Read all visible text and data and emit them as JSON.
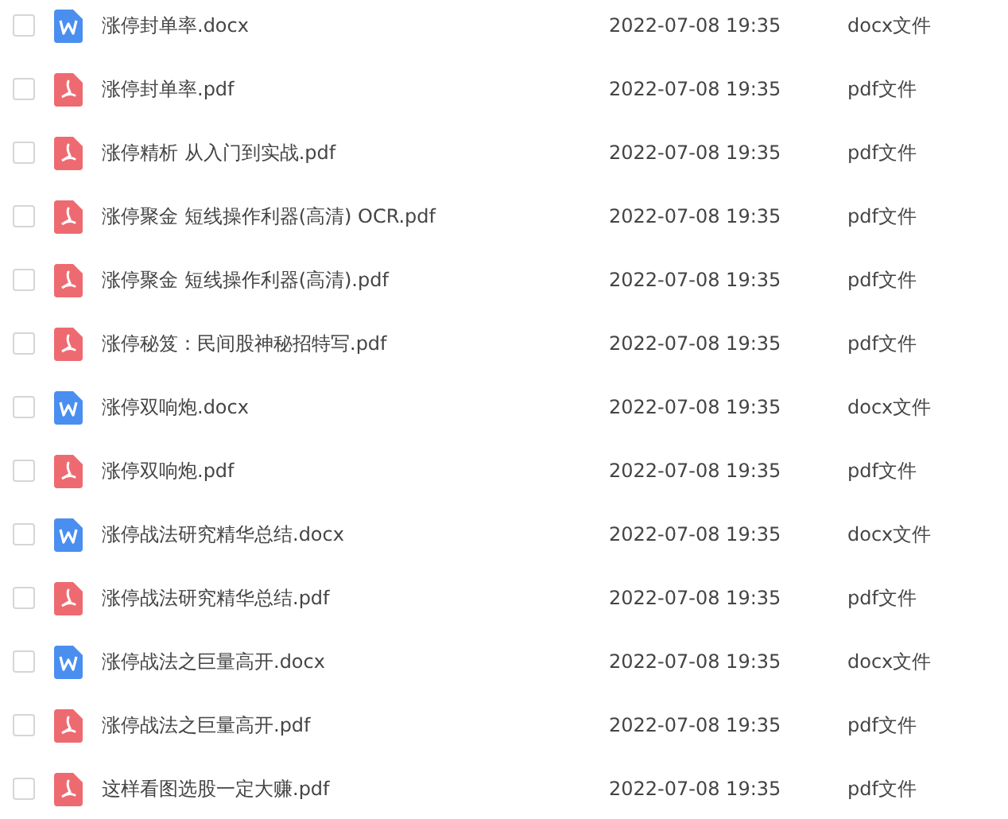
{
  "files": [
    {
      "name": "涨停封单率.docx",
      "kind": "docx",
      "checked": false,
      "date": "2022-07-08 19:35",
      "type": "docx文件"
    },
    {
      "name": "涨停封单率.pdf",
      "kind": "pdf",
      "checked": false,
      "date": "2022-07-08 19:35",
      "type": "pdf文件"
    },
    {
      "name": "涨停精析  从入门到实战.pdf",
      "kind": "pdf",
      "checked": false,
      "date": "2022-07-08 19:35",
      "type": "pdf文件"
    },
    {
      "name": "涨停聚金 短线操作利器(高清) OCR.pdf",
      "kind": "pdf",
      "checked": false,
      "date": "2022-07-08 19:35",
      "type": "pdf文件"
    },
    {
      "name": "涨停聚金 短线操作利器(高清).pdf",
      "kind": "pdf",
      "checked": false,
      "date": "2022-07-08 19:35",
      "type": "pdf文件"
    },
    {
      "name": "涨停秘笈：民间股神秘招特写.pdf",
      "kind": "pdf",
      "checked": false,
      "date": "2022-07-08 19:35",
      "type": "pdf文件"
    },
    {
      "name": "涨停双响炮.docx",
      "kind": "docx",
      "checked": false,
      "date": "2022-07-08 19:35",
      "type": "docx文件"
    },
    {
      "name": "涨停双响炮.pdf",
      "kind": "pdf",
      "checked": false,
      "date": "2022-07-08 19:35",
      "type": "pdf文件"
    },
    {
      "name": "涨停战法研究精华总结.docx",
      "kind": "docx",
      "checked": false,
      "date": "2022-07-08 19:35",
      "type": "docx文件"
    },
    {
      "name": "涨停战法研究精华总结.pdf",
      "kind": "pdf",
      "checked": false,
      "date": "2022-07-08 19:35",
      "type": "pdf文件"
    },
    {
      "name": "涨停战法之巨量高开.docx",
      "kind": "docx",
      "checked": false,
      "date": "2022-07-08 19:35",
      "type": "docx文件"
    },
    {
      "name": "涨停战法之巨量高开.pdf",
      "kind": "pdf",
      "checked": false,
      "date": "2022-07-08 19:35",
      "type": "pdf文件"
    },
    {
      "name": "这样看图选股一定大赚.pdf",
      "kind": "pdf",
      "checked": false,
      "date": "2022-07-08 19:35",
      "type": "pdf文件"
    }
  ]
}
